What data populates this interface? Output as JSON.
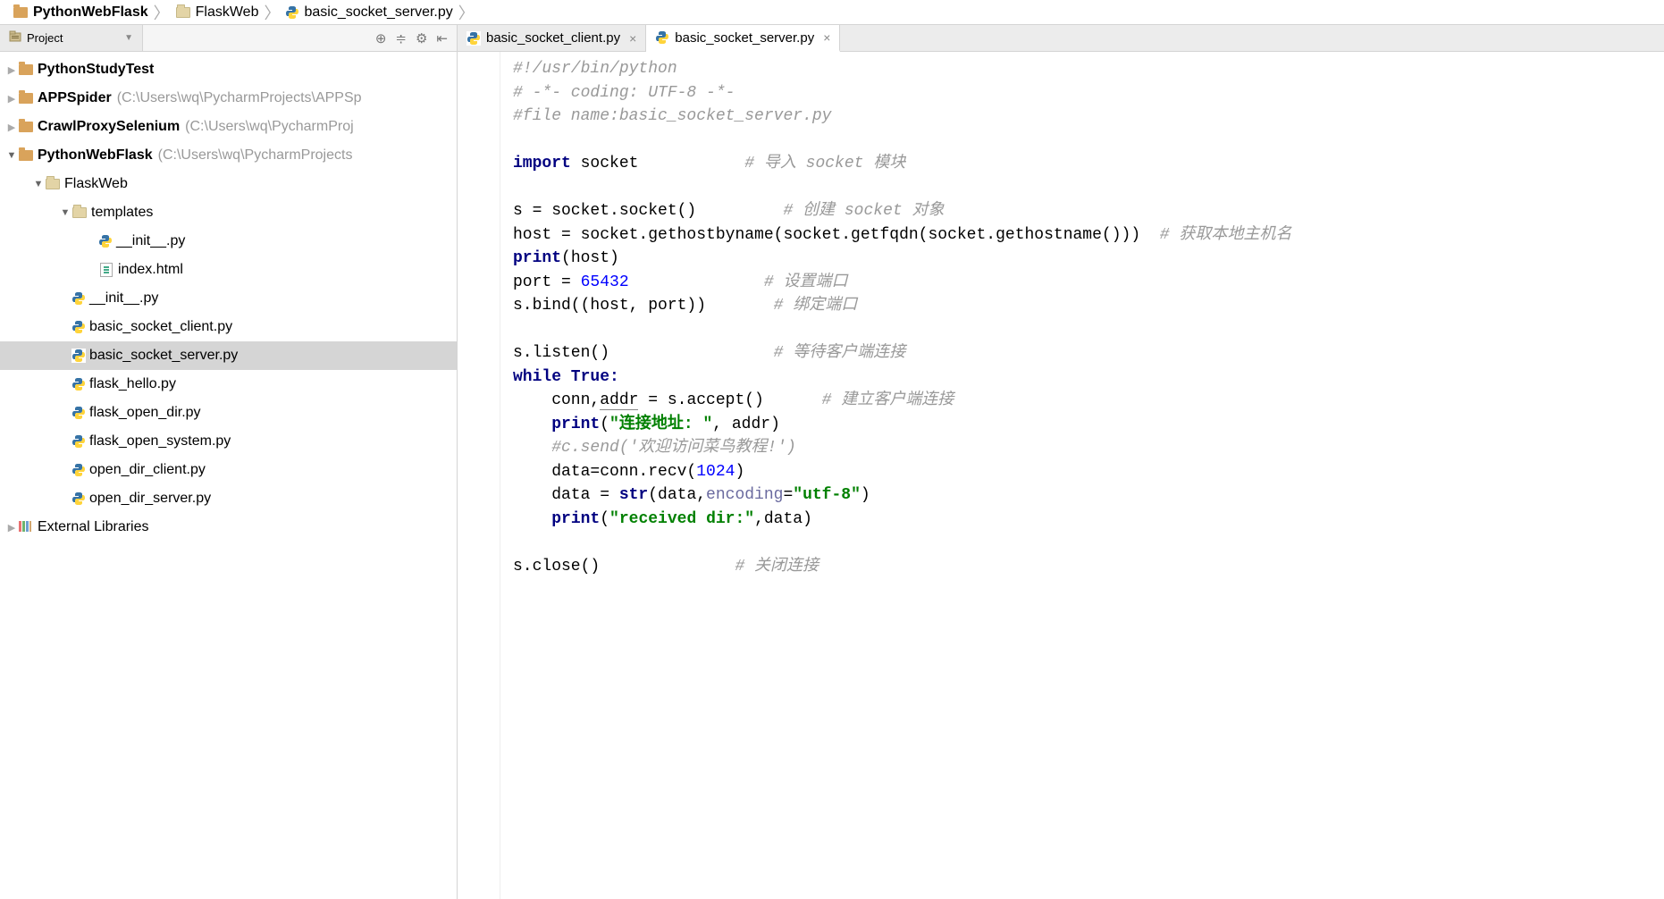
{
  "breadcrumbs": [
    {
      "label": "PythonWebFlask",
      "bold": true,
      "icon": "folder"
    },
    {
      "label": "FlaskWeb",
      "bold": false,
      "icon": "dir"
    },
    {
      "label": "basic_socket_server.py",
      "bold": false,
      "icon": "py"
    }
  ],
  "sidebar": {
    "project_label": "Project",
    "toolbar": [
      "target-icon",
      "collapse-icon",
      "gear-icon",
      "hide-icon"
    ]
  },
  "tree": [
    {
      "depth": 0,
      "arrow": "right",
      "icon": "folder",
      "label": "PythonStudyTest",
      "bold": true
    },
    {
      "depth": 0,
      "arrow": "right",
      "icon": "folder",
      "label": "APPSpider",
      "bold": true,
      "hint": "(C:\\Users\\wq\\PycharmProjects\\APPSp"
    },
    {
      "depth": 0,
      "arrow": "right",
      "icon": "folder",
      "label": "CrawlProxySelenium",
      "bold": true,
      "hint": "(C:\\Users\\wq\\PycharmProj"
    },
    {
      "depth": 0,
      "arrow": "down",
      "icon": "folder",
      "label": "PythonWebFlask",
      "bold": true,
      "hint": "(C:\\Users\\wq\\PycharmProjects"
    },
    {
      "depth": 1,
      "arrow": "down",
      "icon": "dir",
      "label": "FlaskWeb"
    },
    {
      "depth": 2,
      "arrow": "down",
      "icon": "dir",
      "label": "templates"
    },
    {
      "depth": 3,
      "arrow": "",
      "icon": "py",
      "label": "__init__.py"
    },
    {
      "depth": 3,
      "arrow": "",
      "icon": "html",
      "label": "index.html"
    },
    {
      "depth": 2,
      "arrow": "",
      "icon": "py",
      "label": "__init__.py"
    },
    {
      "depth": 2,
      "arrow": "",
      "icon": "py",
      "label": "basic_socket_client.py"
    },
    {
      "depth": 2,
      "arrow": "",
      "icon": "py",
      "label": "basic_socket_server.py",
      "selected": true
    },
    {
      "depth": 2,
      "arrow": "",
      "icon": "py",
      "label": "flask_hello.py"
    },
    {
      "depth": 2,
      "arrow": "",
      "icon": "py",
      "label": "flask_open_dir.py"
    },
    {
      "depth": 2,
      "arrow": "",
      "icon": "py",
      "label": "flask_open_system.py"
    },
    {
      "depth": 2,
      "arrow": "",
      "icon": "py",
      "label": "open_dir_client.py"
    },
    {
      "depth": 2,
      "arrow": "",
      "icon": "py",
      "label": "open_dir_server.py"
    },
    {
      "depth": 0,
      "arrow": "right",
      "icon": "lib",
      "label": "External Libraries"
    }
  ],
  "tabs": [
    {
      "label": "basic_socket_client.py",
      "icon": "py",
      "active": false
    },
    {
      "label": "basic_socket_server.py",
      "icon": "py",
      "active": true
    }
  ],
  "code": {
    "lines": [
      [
        {
          "t": "#!/usr/bin/python",
          "c": "comment"
        }
      ],
      [
        {
          "t": "# -*- coding: UTF-8 -*-",
          "c": "comment"
        }
      ],
      [
        {
          "t": "#file name:basic_socket_server.py",
          "c": "comment"
        }
      ],
      [],
      [
        {
          "t": "import",
          "c": "kw"
        },
        {
          "t": " socket           ",
          "c": ""
        },
        {
          "t": "# 导入 socket 模块",
          "c": "comment"
        }
      ],
      [],
      [
        {
          "t": "s = socket.socket()         ",
          "c": ""
        },
        {
          "t": "# 创建 socket 对象",
          "c": "comment"
        }
      ],
      [
        {
          "t": "host = socket.gethostbyname(socket.getfqdn(socket.gethostname()))  ",
          "c": ""
        },
        {
          "t": "# 获取本地主机名",
          "c": "comment"
        }
      ],
      [
        {
          "t": "print",
          "c": "kw"
        },
        {
          "t": "(host)",
          "c": ""
        }
      ],
      [
        {
          "t": "port = ",
          "c": ""
        },
        {
          "t": "65432",
          "c": "num"
        },
        {
          "t": "              ",
          "c": ""
        },
        {
          "t": "# 设置端口",
          "c": "comment"
        }
      ],
      [
        {
          "t": "s.bind((host, port))       ",
          "c": ""
        },
        {
          "t": "# 绑定端口",
          "c": "comment"
        }
      ],
      [],
      [
        {
          "t": "s.listen()                 ",
          "c": ""
        },
        {
          "t": "# 等待客户端连接",
          "c": "comment"
        }
      ],
      [
        {
          "t": "while True:",
          "c": "kw"
        }
      ],
      [
        {
          "t": "    conn,",
          "c": ""
        },
        {
          "t": "addr",
          "c": "caret"
        },
        {
          "t": " = s.accept()      ",
          "c": ""
        },
        {
          "t": "# 建立客户端连接",
          "c": "comment"
        }
      ],
      [
        {
          "t": "    ",
          "c": ""
        },
        {
          "t": "print",
          "c": "kw"
        },
        {
          "t": "(",
          "c": ""
        },
        {
          "t": "\"连接地址: \"",
          "c": "str"
        },
        {
          "t": ", addr)",
          "c": ""
        }
      ],
      [
        {
          "t": "    ",
          "c": ""
        },
        {
          "t": "#c.send('欢迎访问菜鸟教程!')",
          "c": "comment"
        }
      ],
      [
        {
          "t": "    data=conn.recv(",
          "c": ""
        },
        {
          "t": "1024",
          "c": "num"
        },
        {
          "t": ")",
          "c": ""
        }
      ],
      [
        {
          "t": "    data = ",
          "c": ""
        },
        {
          "t": "str",
          "c": "kw"
        },
        {
          "t": "(data,",
          "c": ""
        },
        {
          "t": "encoding",
          "c": "param"
        },
        {
          "t": "=",
          "c": ""
        },
        {
          "t": "\"utf-8\"",
          "c": "str"
        },
        {
          "t": ")",
          "c": ""
        }
      ],
      [
        {
          "t": "    ",
          "c": ""
        },
        {
          "t": "print",
          "c": "kw"
        },
        {
          "t": "(",
          "c": ""
        },
        {
          "t": "\"received dir:\"",
          "c": "str"
        },
        {
          "t": ",data)",
          "c": ""
        }
      ],
      [],
      [
        {
          "t": "s.close()              ",
          "c": ""
        },
        {
          "t": "# 关闭连接",
          "c": "comment"
        }
      ]
    ]
  }
}
